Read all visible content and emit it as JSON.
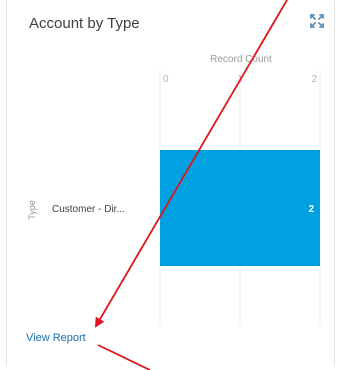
{
  "card": {
    "title": "Account by Type",
    "expand_icon": "expand-icon",
    "view_report_label": "View Report"
  },
  "chart_data": {
    "type": "bar",
    "orientation": "horizontal",
    "categories": [
      "Customer - Dir..."
    ],
    "values": [
      2
    ],
    "data_labels": [
      "2"
    ],
    "xlabel": "Record Count",
    "ylabel": "Type",
    "xlim": [
      0,
      2
    ],
    "xticks": [
      "0",
      "1",
      "2"
    ],
    "grid": true,
    "bar_color": "#00a1e0"
  },
  "annotations": {
    "arrow_color": "#e0141e"
  }
}
